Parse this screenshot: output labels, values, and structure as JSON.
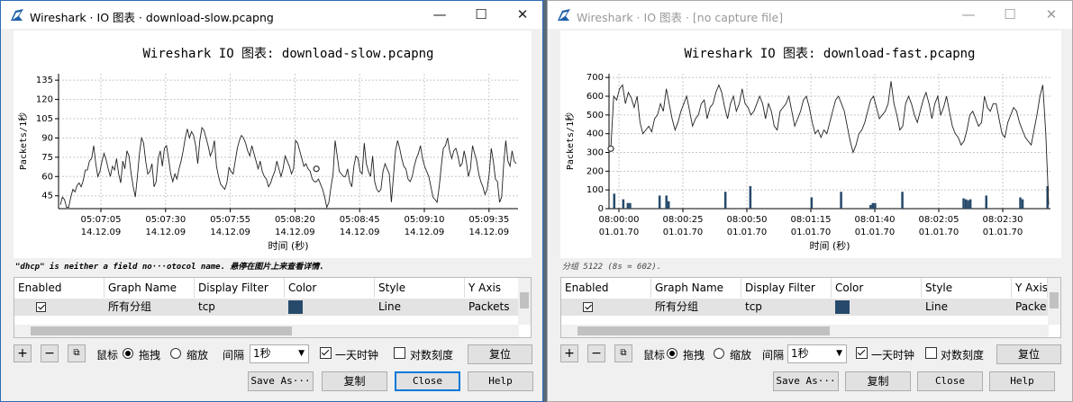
{
  "left_window": {
    "title": "Wireshark · IO 图表 · download-slow.pcapng",
    "status": "\"dhcp\" is neither a field no···otocol name. 悬停在图片上来查看详情.",
    "chart_data": {
      "type": "line",
      "title": "Wireshark IO 图表: download-slow.pcapng",
      "xlabel": "时间 (秒)",
      "ylabel": "Packets/1秒",
      "ylim": [
        35,
        140
      ],
      "yticks": [
        45,
        60,
        75,
        90,
        105,
        120,
        135
      ],
      "xticks": [
        {
          "time": "05:07:05",
          "date": "14.12.09"
        },
        {
          "time": "05:07:30",
          "date": "14.12.09"
        },
        {
          "time": "05:07:55",
          "date": "14.12.09"
        },
        {
          "time": "05:08:20",
          "date": "14.12.09"
        },
        {
          "time": "05:08:45",
          "date": "14.12.09"
        },
        {
          "time": "05:09:10",
          "date": "14.12.09"
        },
        {
          "time": "05:09:35",
          "date": "14.12.09"
        }
      ],
      "grid": true,
      "series": [
        {
          "values": [
            38,
            44,
            42,
            36,
            36,
            44,
            50,
            48,
            53,
            55,
            52,
            57,
            65,
            65,
            72,
            74,
            84,
            70,
            60,
            64,
            72,
            78,
            73,
            66,
            60,
            68,
            65,
            74,
            62,
            55,
            72,
            66,
            80,
            76,
            62,
            52,
            44,
            60,
            78,
            90,
            86,
            72,
            62,
            64,
            70,
            52,
            56,
            74,
            80,
            68,
            82,
            84,
            74,
            62,
            56,
            62,
            58,
            66,
            72,
            80,
            90,
            97,
            90,
            95,
            92,
            84,
            70,
            88,
            98,
            96,
            90,
            84,
            76,
            80,
            88,
            68,
            60,
            54,
            52,
            50,
            55,
            67,
            64,
            62,
            72,
            82,
            88,
            92,
            90,
            86,
            80,
            76,
            84,
            78,
            72,
            66,
            72,
            64,
            60,
            58,
            52,
            55,
            60,
            64,
            72,
            66,
            60,
            66,
            76,
            72,
            68,
            62,
            66,
            88,
            86,
            80,
            74,
            68,
            70,
            66,
            64,
            58,
            56,
            56,
            58,
            54,
            50,
            44,
            36,
            40,
            52,
            62,
            88,
            76,
            64,
            62,
            60,
            60,
            66,
            56,
            52,
            68,
            76,
            74,
            64,
            62,
            86,
            70,
            64,
            60,
            76,
            56,
            50,
            48,
            50,
            64,
            70,
            66,
            62,
            40,
            60,
            80,
            88,
            82,
            74,
            68,
            66,
            58,
            56,
            60,
            68,
            74,
            78,
            84,
            74,
            68,
            64,
            60,
            52,
            44,
            42,
            40,
            52,
            68,
            82,
            84,
            90,
            80,
            74,
            80,
            82,
            76,
            68,
            70,
            80,
            72,
            60,
            66,
            84,
            78,
            72,
            62,
            56,
            52,
            46,
            50,
            62,
            82,
            72,
            58,
            56,
            40,
            44,
            70,
            88,
            72,
            68,
            80,
            72,
            70
          ],
          "marker_value": 66
        }
      ]
    }
  },
  "right_window": {
    "title": "Wireshark · IO 图表 · [no capture file]",
    "status": "分组 5122 (8s = 602).",
    "chart_data": {
      "type": "line",
      "title": "Wireshark IO 图表: download-fast.pcapng",
      "xlabel": "时间 (秒)",
      "ylabel": "Packets/1秒",
      "ylim": [
        0,
        720
      ],
      "yticks": [
        0,
        100,
        200,
        300,
        400,
        500,
        600,
        700
      ],
      "xticks": [
        {
          "time": "08:00:00",
          "date": "01.01.70"
        },
        {
          "time": "08:00:25",
          "date": "01.01.70"
        },
        {
          "time": "08:00:50",
          "date": "01.01.70"
        },
        {
          "time": "08:01:15",
          "date": "01.01.70"
        },
        {
          "time": "08:01:40",
          "date": "01.01.70"
        },
        {
          "time": "08:02:05",
          "date": "01.01.70"
        },
        {
          "time": "08:02:30",
          "date": "01.01.70"
        }
      ],
      "grid": true,
      "series": [
        {
          "values": [
            320,
            600,
            580,
            640,
            660,
            560,
            620,
            590,
            540,
            600,
            460,
            400,
            420,
            440,
            410,
            480,
            500,
            560,
            520,
            640,
            560,
            480,
            420,
            460,
            520,
            560,
            600,
            520,
            440,
            480,
            500,
            560,
            580,
            480,
            540,
            560,
            620,
            660,
            620,
            540,
            480,
            560,
            600,
            520,
            560,
            640,
            560,
            540,
            500,
            520,
            560,
            600,
            560,
            480,
            560,
            520,
            440,
            420,
            520,
            540,
            560,
            600,
            520,
            440,
            480,
            520,
            580,
            600,
            540,
            460,
            400,
            420,
            380,
            420,
            400,
            460,
            520,
            580,
            600,
            560,
            520,
            440,
            360,
            300,
            340,
            400,
            420,
            460,
            520,
            580,
            600,
            540,
            480,
            500,
            520,
            560,
            680,
            560,
            500,
            420,
            440,
            560,
            600,
            560,
            500,
            460,
            520,
            580,
            620,
            560,
            480,
            560,
            600,
            500,
            540,
            600,
            520,
            440,
            400,
            380,
            340,
            360,
            420,
            500,
            520,
            480,
            440,
            460,
            600,
            540,
            520,
            560,
            560,
            480,
            400,
            380,
            460,
            500,
            540,
            520,
            460,
            420,
            380,
            360,
            340,
            420,
            500,
            600,
            660,
            400,
            20
          ],
          "marker_value": 320
        }
      ],
      "bars": [
        0,
        80,
        0,
        0,
        0,
        50,
        0,
        30,
        30,
        0,
        0,
        0,
        0,
        0,
        0,
        0,
        0,
        0,
        0,
        0,
        0,
        70,
        0,
        0,
        70,
        40,
        0,
        0,
        0,
        0,
        0,
        0,
        0,
        0,
        0,
        0,
        0,
        0,
        0,
        0,
        0,
        0,
        0,
        0,
        0,
        0,
        0,
        0,
        0,
        0,
        90,
        0,
        0,
        0,
        0,
        0,
        0,
        0,
        0,
        0,
        0,
        120,
        0,
        0,
        0,
        0,
        0,
        0,
        0,
        0,
        0,
        0,
        0,
        0,
        0,
        0,
        0,
        0,
        0,
        0,
        0,
        0,
        0,
        0,
        0,
        0,
        0,
        0,
        60,
        0,
        0,
        0,
        0,
        0,
        0,
        0,
        0,
        0,
        0,
        0,
        0,
        90,
        0,
        0,
        0,
        0,
        0,
        0,
        0,
        0,
        0,
        0,
        0,
        0,
        20,
        30,
        30,
        0,
        0,
        0,
        0,
        0,
        0,
        0,
        0,
        0,
        0,
        0,
        90,
        0,
        0,
        0,
        0,
        0,
        0,
        0,
        0,
        0,
        0,
        0,
        0,
        0,
        0,
        0,
        0,
        0,
        0,
        0,
        0,
        0,
        0,
        0,
        0,
        0,
        0,
        55,
        50,
        45,
        50,
        0,
        0,
        0,
        0,
        0,
        0,
        70,
        0,
        0,
        0,
        0,
        0,
        0,
        0,
        0,
        0,
        0,
        0,
        0,
        0,
        0,
        60,
        50,
        0,
        0,
        0,
        0,
        0,
        0,
        0,
        0,
        0,
        0,
        120
      ]
    }
  },
  "table": {
    "columns": [
      "Enabled",
      "Graph Name",
      "Display Filter",
      "Color",
      "Style",
      "Y Axis"
    ],
    "row": {
      "graph_name": "所有分组",
      "display_filter": "tcp",
      "color": "#274a6b",
      "style": "Line",
      "y_axis_left": "Packets",
      "y_axis_right": "Packe"
    }
  },
  "controls": {
    "mouse_label": "鼠标",
    "drag_label": "拖拽",
    "zoom_label": "缩放",
    "interval_label": "间隔",
    "interval_value": "1秒",
    "time_of_day_label": "一天时钟",
    "log_scale_label": "对数刻度",
    "reset_label": "复位",
    "save_as_label": "Save As···",
    "copy_label": "复制",
    "close_label": "Close",
    "help_label": "Help"
  },
  "window_buttons": {
    "minimize": "—",
    "maximize": "☐",
    "close": "✕"
  }
}
